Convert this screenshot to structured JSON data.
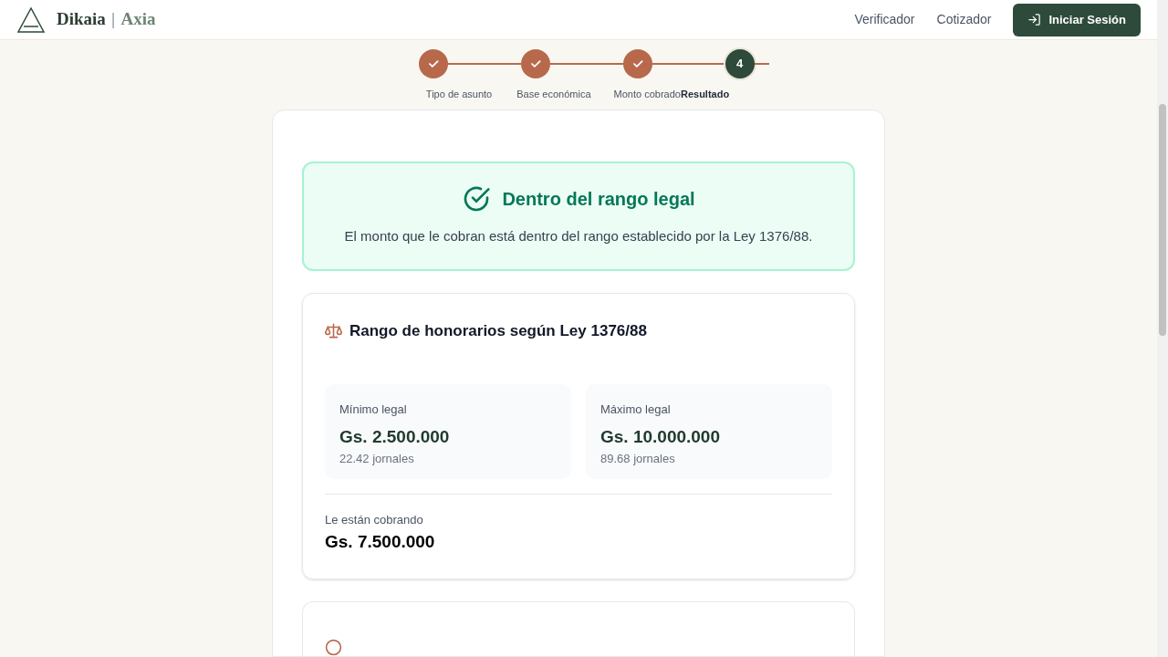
{
  "header": {
    "brand": "Dikaia",
    "separator": "|",
    "brand_suffix": "Axia",
    "nav": [
      "Verificador",
      "Cotizador"
    ],
    "login_button": "Iniciar Sesión"
  },
  "steps": [
    {
      "label": "Tipo de asunto",
      "completed": true,
      "selected": false
    },
    {
      "label": "Base económica",
      "completed": true,
      "selected": false
    },
    {
      "label": "Monto cobrado",
      "completed": true,
      "selected": false
    },
    {
      "label": "Resultado",
      "number": "4",
      "completed": false,
      "selected": true
    }
  ],
  "verdict": {
    "kind": "ok",
    "title": "Dentro del rango legal",
    "message": "El monto que le cobran está dentro del rango establecido por la Ley 1376/88."
  },
  "range": {
    "title": "Rango de honorarios según Ley 1376/88",
    "limits": [
      {
        "label": "Mínimo legal",
        "amount": "Gs. 2.500.000",
        "jornales": "22.42 jornales"
      },
      {
        "label": "Máximo legal",
        "amount": "Gs. 10.000.000",
        "jornales": "89.68 jornales"
      }
    ],
    "charged_label": "Le están cobrando",
    "charged_amount": "Gs. 7.500.000"
  }
}
